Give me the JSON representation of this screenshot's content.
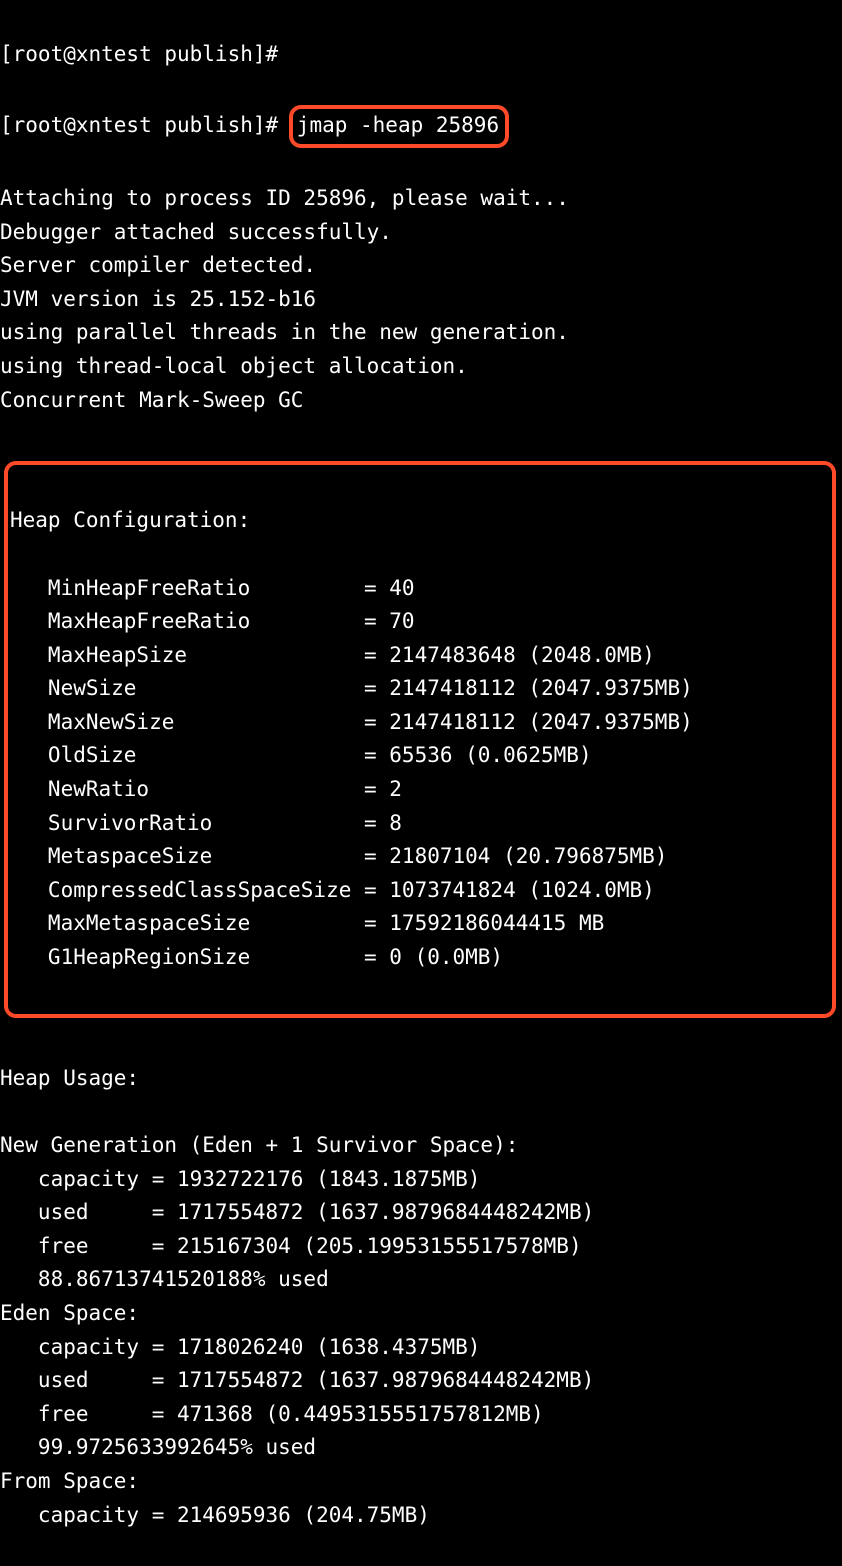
{
  "prompt1": "[root@xntest publish]#",
  "prompt2": "[root@xntest publish]# ",
  "command": "jmap -heap 25896",
  "pre_lines": [
    "Attaching to process ID 25896, please wait...",
    "Debugger attached successfully.",
    "Server compiler detected.",
    "JVM version is 25.152-b16",
    "",
    "using parallel threads in the new generation.",
    "using thread-local object allocation.",
    "Concurrent Mark-Sweep GC"
  ],
  "heap_config_title": "Heap Configuration:",
  "heap_config": [
    {
      "name": "MinHeapFreeRatio",
      "value": "40"
    },
    {
      "name": "MaxHeapFreeRatio",
      "value": "70"
    },
    {
      "name": "MaxHeapSize",
      "value": "2147483648 (2048.0MB)"
    },
    {
      "name": "NewSize",
      "value": "2147418112 (2047.9375MB)"
    },
    {
      "name": "MaxNewSize",
      "value": "2147418112 (2047.9375MB)"
    },
    {
      "name": "OldSize",
      "value": "65536 (0.0625MB)"
    },
    {
      "name": "NewRatio",
      "value": "2"
    },
    {
      "name": "SurvivorRatio",
      "value": "8"
    },
    {
      "name": "MetaspaceSize",
      "value": "21807104 (20.796875MB)"
    },
    {
      "name": "CompressedClassSpaceSize",
      "value": "1073741824 (1024.0MB)"
    },
    {
      "name": "MaxMetaspaceSize",
      "value": "17592186044415 MB"
    },
    {
      "name": "G1HeapRegionSize",
      "value": "0 (0.0MB)"
    }
  ],
  "heap_usage_title": "Heap Usage:",
  "sections": [
    {
      "title": "New Generation (Eden + 1 Survivor Space):",
      "rows": [
        {
          "label": "capacity",
          "value": "1932722176 (1843.1875MB)"
        },
        {
          "label": "used",
          "value": "1717554872 (1637.9879684448242MB)"
        },
        {
          "label": "free",
          "value": "215167304 (205.19953155517578MB)"
        }
      ],
      "pct": "88.86713741520188% used"
    },
    {
      "title": "Eden Space:",
      "rows": [
        {
          "label": "capacity",
          "value": "1718026240 (1638.4375MB)"
        },
        {
          "label": "used",
          "value": "1717554872 (1637.9879684448242MB)"
        },
        {
          "label": "free",
          "value": "471368 (0.4495315551757812MB)"
        }
      ],
      "pct": "99.9725633992645% used"
    },
    {
      "title": "From Space:",
      "rows": [
        {
          "label": "capacity",
          "value": "214695936 (204.75MB)"
        }
      ]
    }
  ]
}
